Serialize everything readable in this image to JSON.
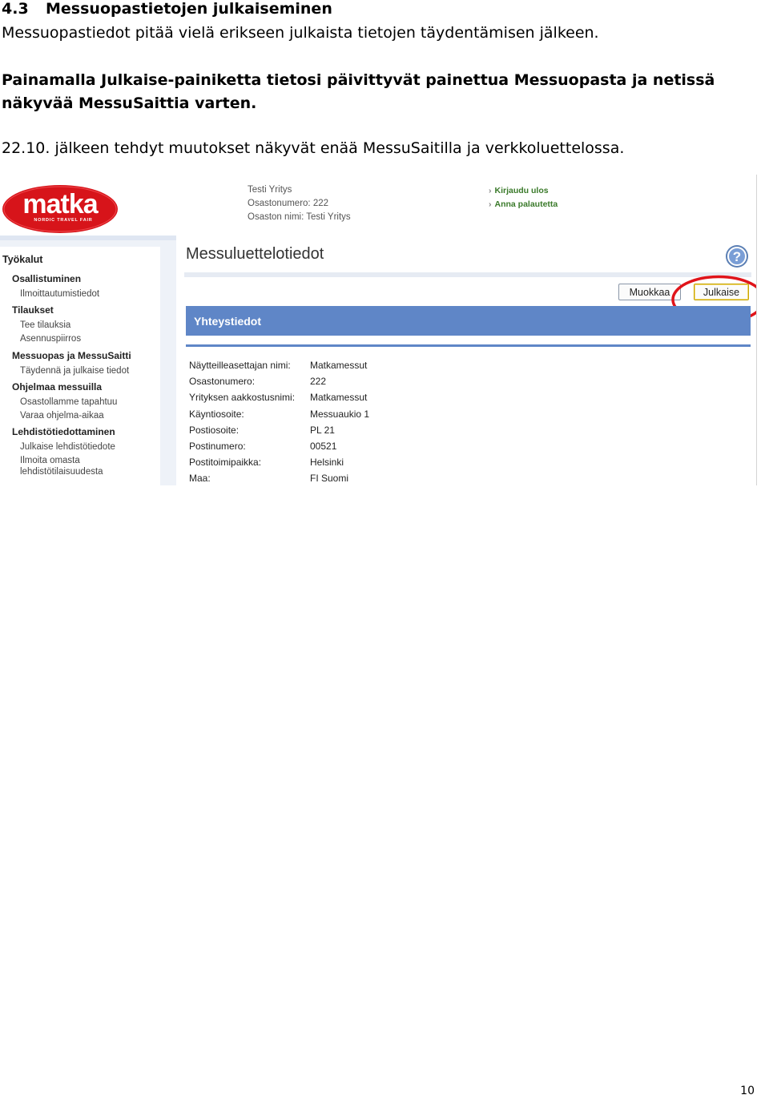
{
  "document": {
    "section_number": "4.3",
    "section_title": "Messuopastietojen julkaiseminen",
    "intro": "Messuopastiedot pitää vielä erikseen julkaista tietojen täydentämisen jälkeen.",
    "instruction": "Painamalla Julkaise-painiketta tietosi päivittyvät painettua Messuopasta ja netissä näkyvää MessuSaittia varten.",
    "note": "22.10. jälkeen tehdyt muutokset näkyvät enää MessuSaitilla ja verkkoluettelossa.",
    "page_number": "10"
  },
  "screenshot": {
    "logo": {
      "text": "matka",
      "subtext": "NORDIC TRAVEL FAIR",
      "color": "#d7141a"
    },
    "user_info": {
      "company": "Testi Yritys",
      "stand_number": "Osastonumero: 222",
      "stand_name": "Osaston nimi: Testi Yritys"
    },
    "top_links": [
      "Kirjaudu ulos",
      "Anna palautetta"
    ],
    "sidebar": {
      "title": "Työkalut",
      "items": [
        {
          "type": "section",
          "label": "Osallistuminen"
        },
        {
          "type": "link",
          "label": "Ilmoittautumistiedot"
        },
        {
          "type": "section",
          "label": "Tilaukset"
        },
        {
          "type": "link",
          "label": "Tee tilauksia"
        },
        {
          "type": "link",
          "label": "Asennuspiirros"
        },
        {
          "type": "section",
          "label": "Messuopas ja MessuSaitti"
        },
        {
          "type": "link",
          "label": "Täydennä ja julkaise tiedot"
        },
        {
          "type": "section",
          "label": "Ohjelmaa messuilla"
        },
        {
          "type": "link",
          "label": "Osastollamme tapahtuu"
        },
        {
          "type": "link",
          "label": "Varaa ohjelma-aikaa"
        },
        {
          "type": "section",
          "label": "Lehdistötiedottaminen"
        },
        {
          "type": "link",
          "label": "Julkaise lehdistötiedote"
        },
        {
          "type": "link",
          "label": "Ilmoita omasta"
        },
        {
          "type": "link",
          "label": "lehdistötilaisuudesta"
        }
      ]
    },
    "main_title": "Messuluettelotiedot",
    "help_icon": "help-icon",
    "buttons": {
      "edit": "Muokkaa",
      "publish": "Julkaise"
    },
    "highlight_color": "#e0141a",
    "section_title": "Yhteystiedot",
    "accent_color": "#5f86c7",
    "fields": [
      {
        "label": "Näytteilleasettajan nimi:",
        "value": "Matkamessut"
      },
      {
        "label": "Osastonumero:",
        "value": "222"
      },
      {
        "label": "Yrityksen aakkostusnimi:",
        "value": "Matkamessut"
      },
      {
        "label": "Käyntiosoite:",
        "value": "Messuaukio 1"
      },
      {
        "label": "Postiosoite:",
        "value": "PL 21"
      },
      {
        "label": "Postinumero:",
        "value": "00521"
      },
      {
        "label": "Postitoimipaikka:",
        "value": "Helsinki"
      },
      {
        "label": "Maa:",
        "value": "FI Suomi"
      }
    ]
  }
}
